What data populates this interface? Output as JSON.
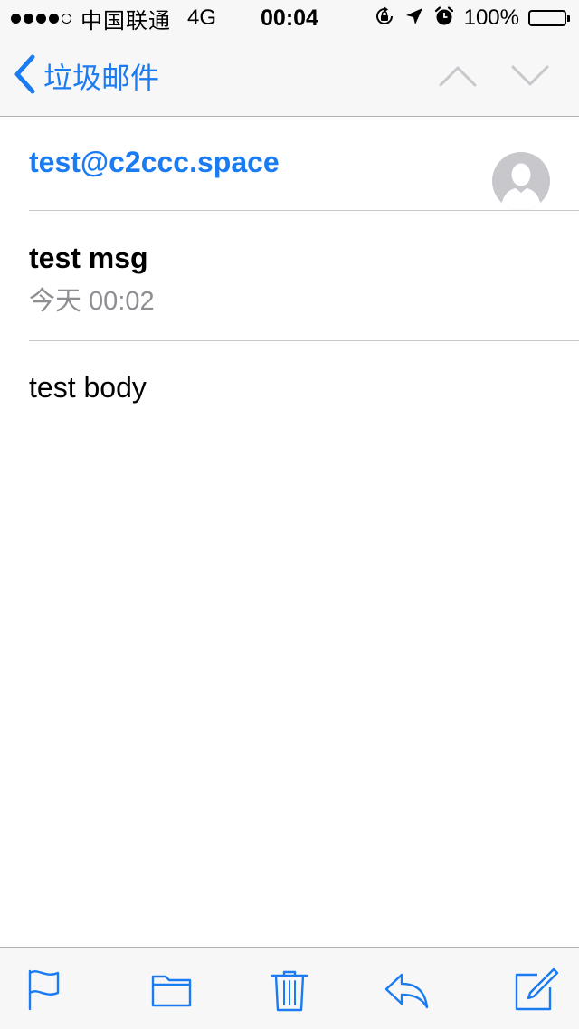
{
  "status_bar": {
    "carrier": "中国联通",
    "network": "4G",
    "time": "00:04",
    "battery": "100%",
    "battery_level": 1.0
  },
  "nav": {
    "back_label": "垃圾邮件",
    "accent_color": "#1a7bf2"
  },
  "message": {
    "sender": "test@c2ccc.space",
    "subject": "test msg",
    "date": "今天 00:02",
    "body": "test body"
  },
  "toolbar": {
    "icons": [
      "flag-icon",
      "folder-icon",
      "trash-icon",
      "reply-icon",
      "compose-icon"
    ]
  }
}
